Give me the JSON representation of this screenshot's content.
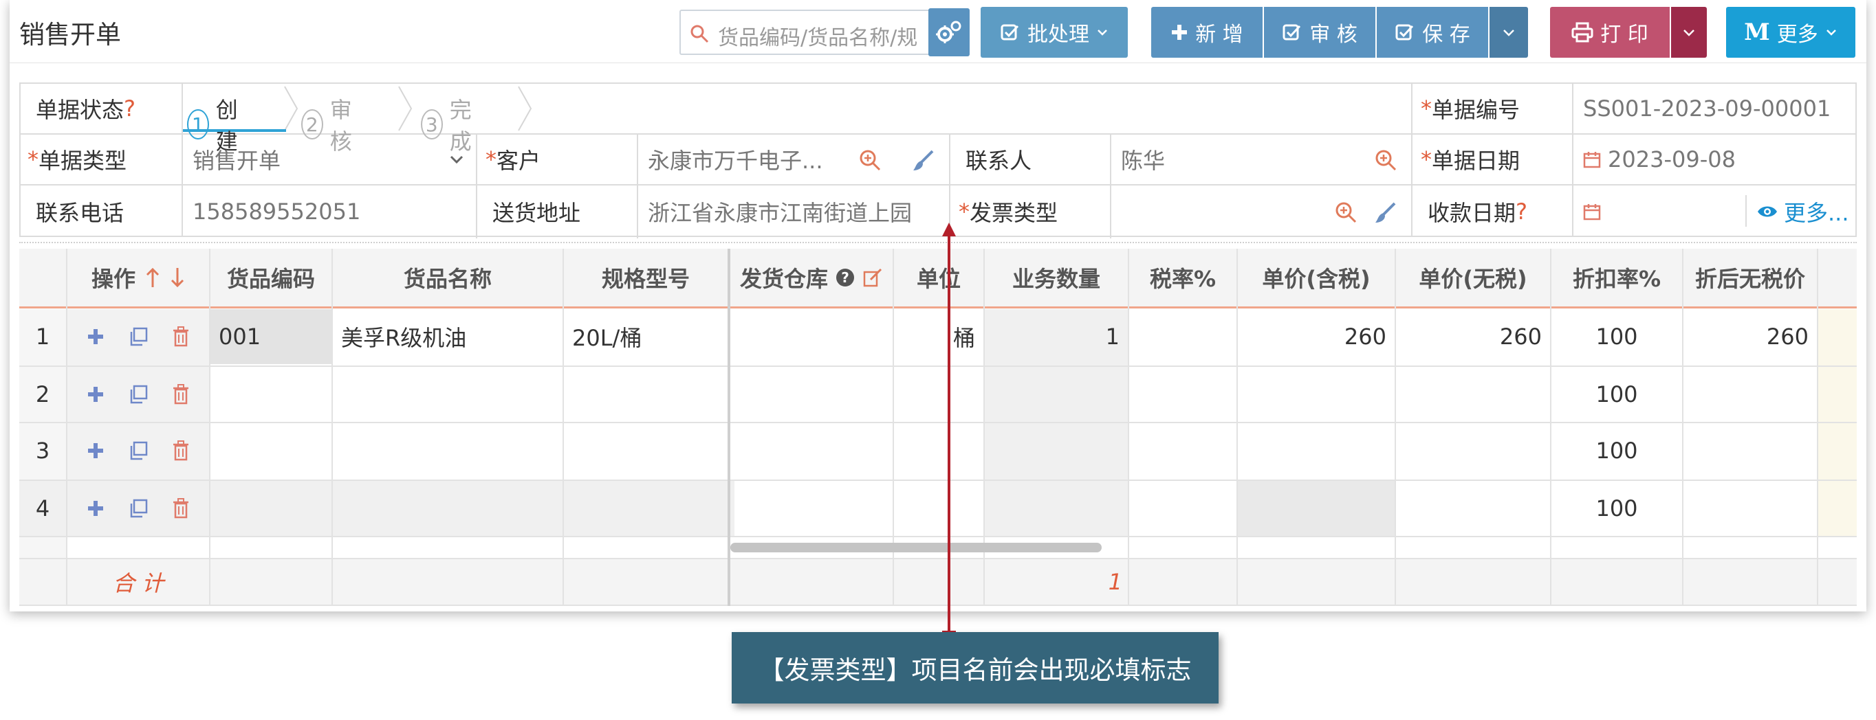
{
  "header": {
    "title": "销售开单",
    "search_placeholder": "货品编码/货品名称/规",
    "batch_label": "批处理",
    "new_label": "新 增",
    "audit_label": "审 核",
    "save_label": "保 存",
    "print_label": "打 印",
    "more_label": "更多",
    "more_icon_letter": "M"
  },
  "form": {
    "status_label": "单据状态",
    "status_help": "?",
    "steps": [
      {
        "num": "1",
        "label": "创建"
      },
      {
        "num": "2",
        "label": "审核"
      },
      {
        "num": "3",
        "label": "完成"
      }
    ],
    "doc_no_label": "单据编号",
    "doc_no_value": "SS001-2023-09-00001",
    "doc_type_label": "单据类型",
    "doc_type_value": "销售开单",
    "customer_label": "客户",
    "customer_value": "永康市万千电子...",
    "contact_label": "联系人",
    "contact_value": "陈华",
    "doc_date_label": "单据日期",
    "doc_date_value": "2023-09-08",
    "phone_label": "联系电话",
    "phone_value": "158589552051",
    "address_label": "送货地址",
    "address_value": "浙江省永康市江南街道上园",
    "invoice_label": "发票类型",
    "invoice_value": "",
    "pay_date_label": "收款日期",
    "pay_date_help": "?",
    "pay_date_value": "",
    "more_link": "更多..."
  },
  "table": {
    "columns": [
      "操作",
      "货品编码",
      "货品名称",
      "规格型号",
      "发货仓库",
      "单位",
      "业务数量",
      "税率%",
      "单价(含税)",
      "单价(无税)",
      "折扣率%",
      "折后无税价"
    ],
    "rows": [
      {
        "no": "1",
        "code": "001",
        "name": "美孚R级机油",
        "spec": "20L/桶",
        "warehouse": "",
        "unit": "桶",
        "qty": "1",
        "tax": "",
        "price_tax": "260",
        "price_notax": "260",
        "discount": "100",
        "disc_price": "260"
      },
      {
        "no": "2",
        "code": "",
        "name": "",
        "spec": "",
        "warehouse": "",
        "unit": "",
        "qty": "",
        "tax": "",
        "price_tax": "",
        "price_notax": "",
        "discount": "100",
        "disc_price": ""
      },
      {
        "no": "3",
        "code": "",
        "name": "",
        "spec": "",
        "warehouse": "",
        "unit": "",
        "qty": "",
        "tax": "",
        "price_tax": "",
        "price_notax": "",
        "discount": "100",
        "disc_price": ""
      },
      {
        "no": "4",
        "code": "",
        "name": "",
        "spec": "",
        "warehouse": "",
        "unit": "",
        "qty": "",
        "tax": "",
        "price_tax": "",
        "price_notax": "",
        "discount": "100",
        "disc_price": ""
      }
    ],
    "total_label": "合 计",
    "total_qty": "1"
  },
  "callout": {
    "text": "【发票类型】项目名前会出现必填标志"
  },
  "colors": {
    "primary": "#5a93c0",
    "print": "#c0526f",
    "more": "#1a9fd6",
    "required": "#e05c3a",
    "callout_bg": "#35657b",
    "arrow": "#b3202a"
  }
}
